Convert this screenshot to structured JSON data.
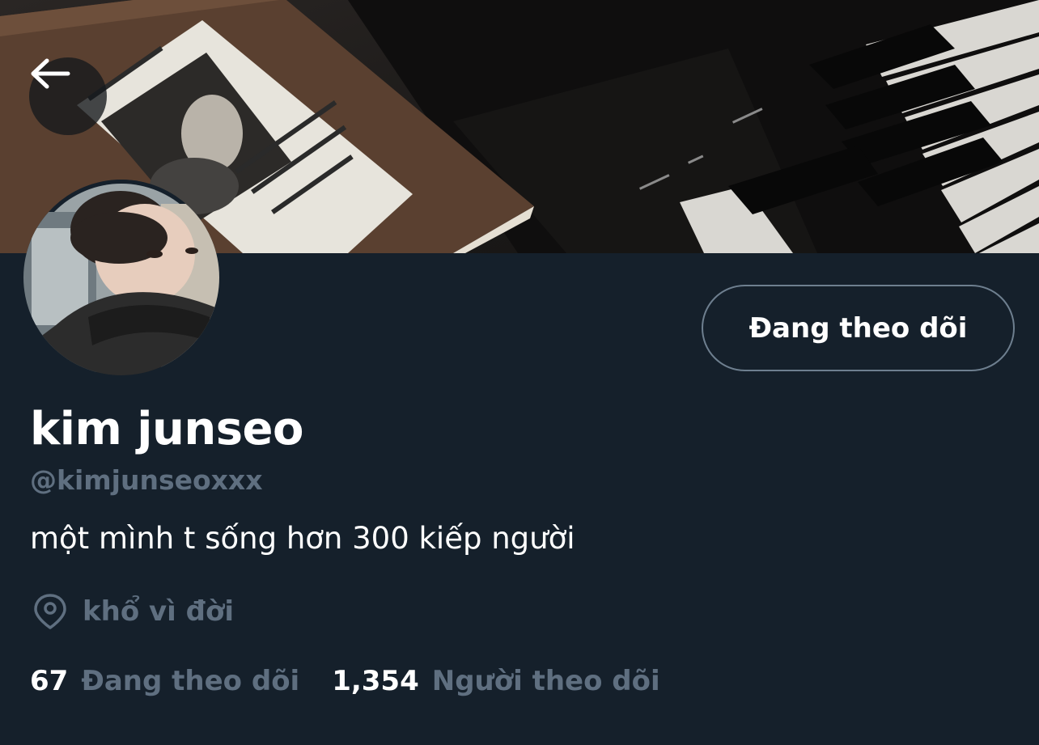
{
  "header": {
    "back_icon": "arrow-left-icon",
    "banner_image": "profile-banner-photo"
  },
  "profile": {
    "display_name": "kim junseo",
    "handle": "@kimjunseoxxx",
    "bio": "một mình t sống hơn 300 kiếp người",
    "location": "khổ vì đời",
    "location_icon": "location-pin-icon",
    "avatar_image": "profile-avatar-photo"
  },
  "actions": {
    "follow_button_label": "Đang theo dõi"
  },
  "stats": {
    "following_count": "67",
    "following_label": "Đang theo dõi",
    "followers_count": "1,354",
    "followers_label": "Người theo dõi"
  },
  "colors": {
    "background": "#15202b",
    "primary_text": "#ffffff",
    "secondary_text": "#5f6f80",
    "button_border": "#6e7f8f"
  }
}
